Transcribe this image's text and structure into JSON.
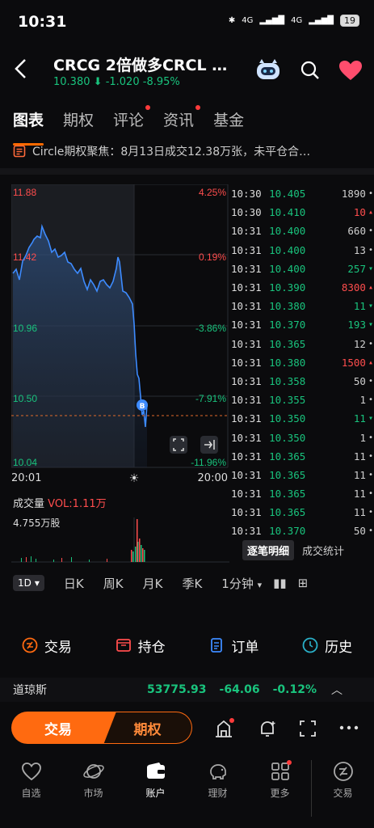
{
  "status_bar": {
    "time": "10:31",
    "net1": "4G",
    "net2": "4G",
    "battery": "19"
  },
  "header": {
    "symbol": "CRCG  2倍做多CRCL …",
    "price": "10.380",
    "change": "-1.020",
    "change_pct": "-8.95%",
    "colors": {
      "down": "#19c37d",
      "up": "#ff4d4d",
      "accent": "#ff6a00"
    }
  },
  "tabs": [
    {
      "label": "图表",
      "dot": false
    },
    {
      "label": "期权",
      "dot": false
    },
    {
      "label": "评论",
      "dot": true
    },
    {
      "label": "资讯",
      "dot": true
    },
    {
      "label": "基金",
      "dot": false
    }
  ],
  "news": "Circle期权聚焦：8月13日成交12.38万张，未平仓合…",
  "chart": {
    "y_left": [
      "11.88",
      "11.42",
      "10.96",
      "10.50",
      "10.04"
    ],
    "y_right": [
      "4.25%",
      "0.19%",
      "-3.86%",
      "-7.91%",
      "-11.96%"
    ],
    "x_left": "20:01",
    "x_right": "20:00",
    "marker": "B"
  },
  "volume": {
    "label": "成交量",
    "vol_label": "VOL:1.11万",
    "max_label": "4.755万股"
  },
  "trades": [
    {
      "t": "10:30",
      "p": "10.405",
      "v": "1890",
      "c": "n"
    },
    {
      "t": "10:30",
      "p": "10.410",
      "v": "10",
      "c": "u"
    },
    {
      "t": "10:31",
      "p": "10.400",
      "v": "660",
      "c": "n"
    },
    {
      "t": "10:31",
      "p": "10.400",
      "v": "13",
      "c": "n"
    },
    {
      "t": "10:31",
      "p": "10.400",
      "v": "257",
      "c": "d"
    },
    {
      "t": "10:31",
      "p": "10.390",
      "v": "8300",
      "c": "u"
    },
    {
      "t": "10:31",
      "p": "10.380",
      "v": "11",
      "c": "d"
    },
    {
      "t": "10:31",
      "p": "10.370",
      "v": "193",
      "c": "d"
    },
    {
      "t": "10:31",
      "p": "10.365",
      "v": "12",
      "c": "n"
    },
    {
      "t": "10:31",
      "p": "10.380",
      "v": "1500",
      "c": "u"
    },
    {
      "t": "10:31",
      "p": "10.358",
      "v": "50",
      "c": "n"
    },
    {
      "t": "10:31",
      "p": "10.355",
      "v": "1",
      "c": "n"
    },
    {
      "t": "10:31",
      "p": "10.350",
      "v": "11",
      "c": "d"
    },
    {
      "t": "10:31",
      "p": "10.350",
      "v": "1",
      "c": "n"
    },
    {
      "t": "10:31",
      "p": "10.365",
      "v": "11",
      "c": "n"
    },
    {
      "t": "10:31",
      "p": "10.365",
      "v": "11",
      "c": "n"
    },
    {
      "t": "10:31",
      "p": "10.365",
      "v": "11",
      "c": "n"
    },
    {
      "t": "10:31",
      "p": "10.365",
      "v": "11",
      "c": "n"
    },
    {
      "t": "10:31",
      "p": "10.370",
      "v": "50",
      "c": "n"
    }
  ],
  "trade_tabs": {
    "active": "逐笔明细",
    "other": "成交统计"
  },
  "periods": [
    "1D",
    "日K",
    "周K",
    "月K",
    "季K",
    "1分钟"
  ],
  "actions": [
    "交易",
    "持仓",
    "订单",
    "历史"
  ],
  "dow": {
    "name": "道琼斯",
    "value": "53775.93",
    "change": "-64.06",
    "pct": "-0.12%"
  },
  "bottom": {
    "trade": "交易",
    "options": "期权"
  },
  "nav": [
    "自选",
    "市场",
    "账户",
    "理财",
    "更多",
    "交易"
  ]
}
